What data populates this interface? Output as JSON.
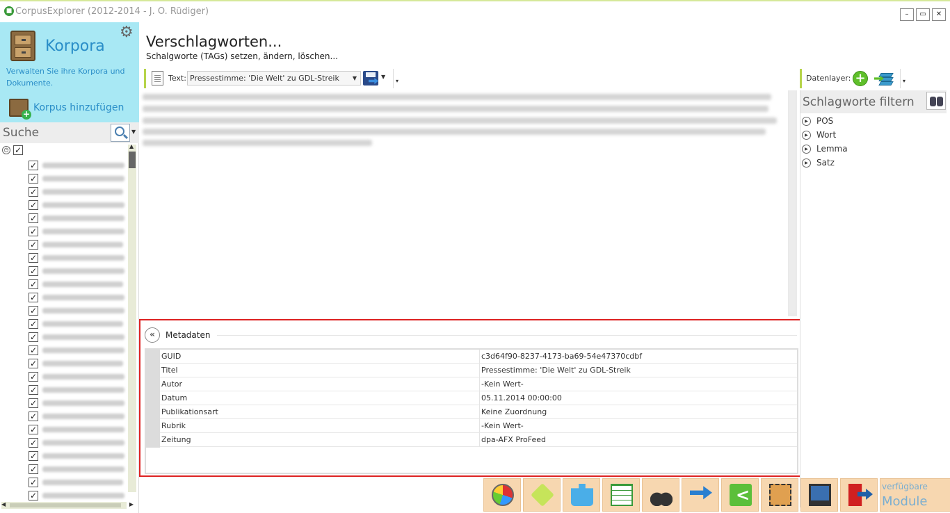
{
  "window": {
    "title": "CorpusExplorer (2012-2014 - J. O. Rüdiger)",
    "minimize": "–",
    "restore": "▭",
    "close": "✕"
  },
  "sidebar": {
    "title": "Korpora",
    "description": "Verwalten Sie ihre Korpora und Dokumente.",
    "add_corpus": "Korpus hinzufügen",
    "search_label": "Suche",
    "item_count": 26
  },
  "main": {
    "title": "Verschlagworten...",
    "subtitle": "Schalgworte (TAGs) setzen, ändern, löschen...",
    "toolbar": {
      "text_label": "Text:",
      "selected_text": "Pressestimme: 'Die Welt' zu GDL-Streik"
    },
    "layer_toolbar": {
      "label": "Datenlayer:"
    }
  },
  "metadata": {
    "title": "Metadaten",
    "rows": [
      {
        "key": "GUID",
        "value": "c3d64f90-8237-4173-ba69-54e47370cdbf"
      },
      {
        "key": "Titel",
        "value": "Pressestimme: 'Die Welt' zu GDL-Streik"
      },
      {
        "key": "Autor",
        "value": "-Kein Wert-"
      },
      {
        "key": "Datum",
        "value": "05.11.2014 00:00:00"
      },
      {
        "key": "Publikationsart",
        "value": "Keine Zuordnung"
      },
      {
        "key": "Rubrik",
        "value": "-Kein Wert-"
      },
      {
        "key": "Zeitung",
        "value": "dpa-AFX ProFeed"
      }
    ]
  },
  "filter": {
    "title": "Schlagworte filtern",
    "items": [
      "POS",
      "Wort",
      "Lemma",
      "Satz"
    ]
  },
  "modules": {
    "icons": [
      "pie-chart-icon",
      "tag-icon",
      "puzzle-icon",
      "table-icon",
      "binoculars-icon",
      "shuffle-icon",
      "share-icon",
      "chip-icon",
      "monitor-icon",
      "exit-icon"
    ],
    "more_line1": "verfügbare",
    "more_line2": "Module"
  }
}
